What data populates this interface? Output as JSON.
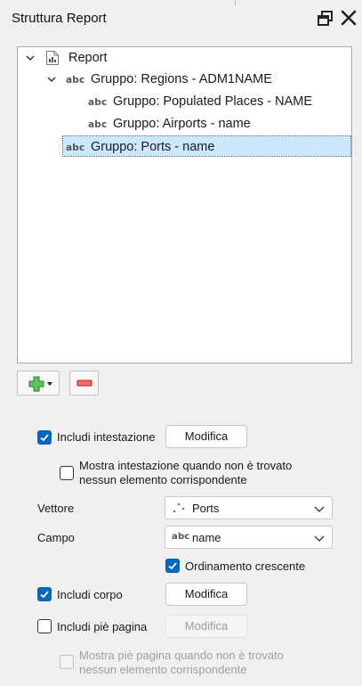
{
  "panel": {
    "title": "Struttura Report"
  },
  "tree": {
    "root": {
      "label": "Report",
      "icon": "report-icon"
    },
    "items": [
      {
        "label": "Gruppo: Regions - ADM1NAME",
        "type_badge": "abc",
        "expanded": true
      },
      {
        "label": "Gruppo: Populated Places - NAME",
        "type_badge": "abc"
      },
      {
        "label": "Gruppo: Airports - name",
        "type_badge": "abc"
      },
      {
        "label": "Gruppo: Ports - name",
        "type_badge": "abc",
        "selected": true
      }
    ]
  },
  "toolbar": {
    "add_icon": "add-section-icon",
    "remove_icon": "remove-section-icon"
  },
  "options": {
    "include_header": {
      "label": "Includi intestazione",
      "checked": true,
      "button": "Modifica"
    },
    "show_header_no_match": {
      "line1": "Mostra intestazione quando non è trovato",
      "line2": "nessun elemento corrispondente",
      "checked": false
    },
    "layer": {
      "label": "Vettore",
      "value": "Ports",
      "icon": "point-layer-icon"
    },
    "field": {
      "label": "Campo",
      "value": "name",
      "badge": "abc"
    },
    "sort_ascending": {
      "label": "Ordinamento crescente",
      "checked": true
    },
    "include_body": {
      "label": "Includi corpo",
      "checked": true,
      "button": "Modifica"
    },
    "include_footer": {
      "label": "Includi piè pagina",
      "checked": false,
      "button": "Modifica"
    },
    "show_footer_no_match": {
      "line1": "Mostra piè pagina quando non è trovato",
      "line2": "nessun elemento corrispondente",
      "checked": false,
      "disabled": true
    }
  },
  "colors": {
    "accent": "#0067c0",
    "selection": "#cce8ff",
    "add_icon": "#3aa33a",
    "remove_icon": "#e03030"
  }
}
